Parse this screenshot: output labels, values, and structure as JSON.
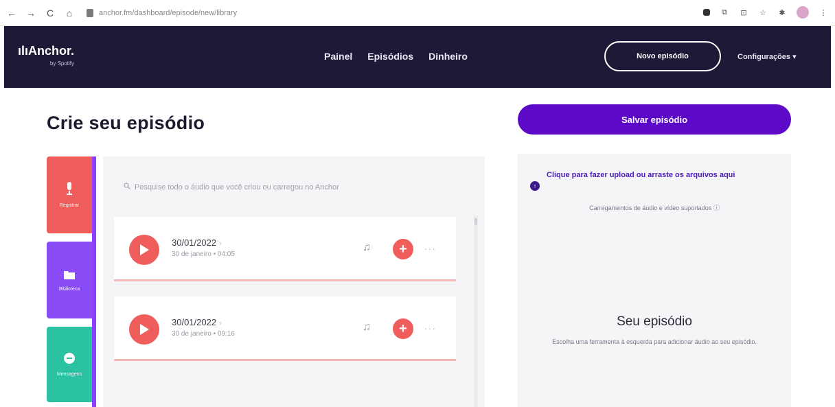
{
  "browser": {
    "url": "anchor.fm/dashboard/episode/new/library",
    "back": "←",
    "forward": "→",
    "reload": "C",
    "home": "⌂"
  },
  "header": {
    "logo_text": "Anchor.",
    "logo_mark": "ılı",
    "logo_sub": "by Spotify",
    "nav": [
      "Painel",
      "Episódios",
      "Dinheiro"
    ],
    "new_episode": "Novo episódio",
    "settings": "Configurações ▾"
  },
  "page": {
    "title": "Crie seu episódio"
  },
  "tools": [
    {
      "label": "Registrar",
      "icon": "microphone-icon",
      "color": "#ef5d5d"
    },
    {
      "label": "Biblioteca",
      "icon": "folder-icon",
      "color": "#8a4cf6"
    },
    {
      "label": "Mensagens",
      "icon": "message-icon",
      "color": "#2bc2a4"
    }
  ],
  "library": {
    "search_placeholder": "Pesquise todo o áudio que você criou ou carregou no Anchor",
    "items": [
      {
        "title": "30/01/2022",
        "subtitle": "30 de janeiro  •  04:05"
      },
      {
        "title": "30/01/2022",
        "subtitle": "30 de janeiro  •  09:16"
      }
    ]
  },
  "episode": {
    "save_label": "Salvar episódio",
    "upload_text": "Clique para fazer upload ou arraste os arquivos aqui",
    "supported": "Carregamentos de áudio e vídeo suportados",
    "title": "Seu episódio",
    "description": "Escolha uma ferramenta à esquerda para adicionar áudio ao seu episódio."
  },
  "colors": {
    "header_bg": "#1c1a36",
    "accent_purple": "#5c0ac7",
    "record_red": "#ef5d5d",
    "library_purple": "#8a4cf6",
    "messages_teal": "#2bc2a4"
  }
}
